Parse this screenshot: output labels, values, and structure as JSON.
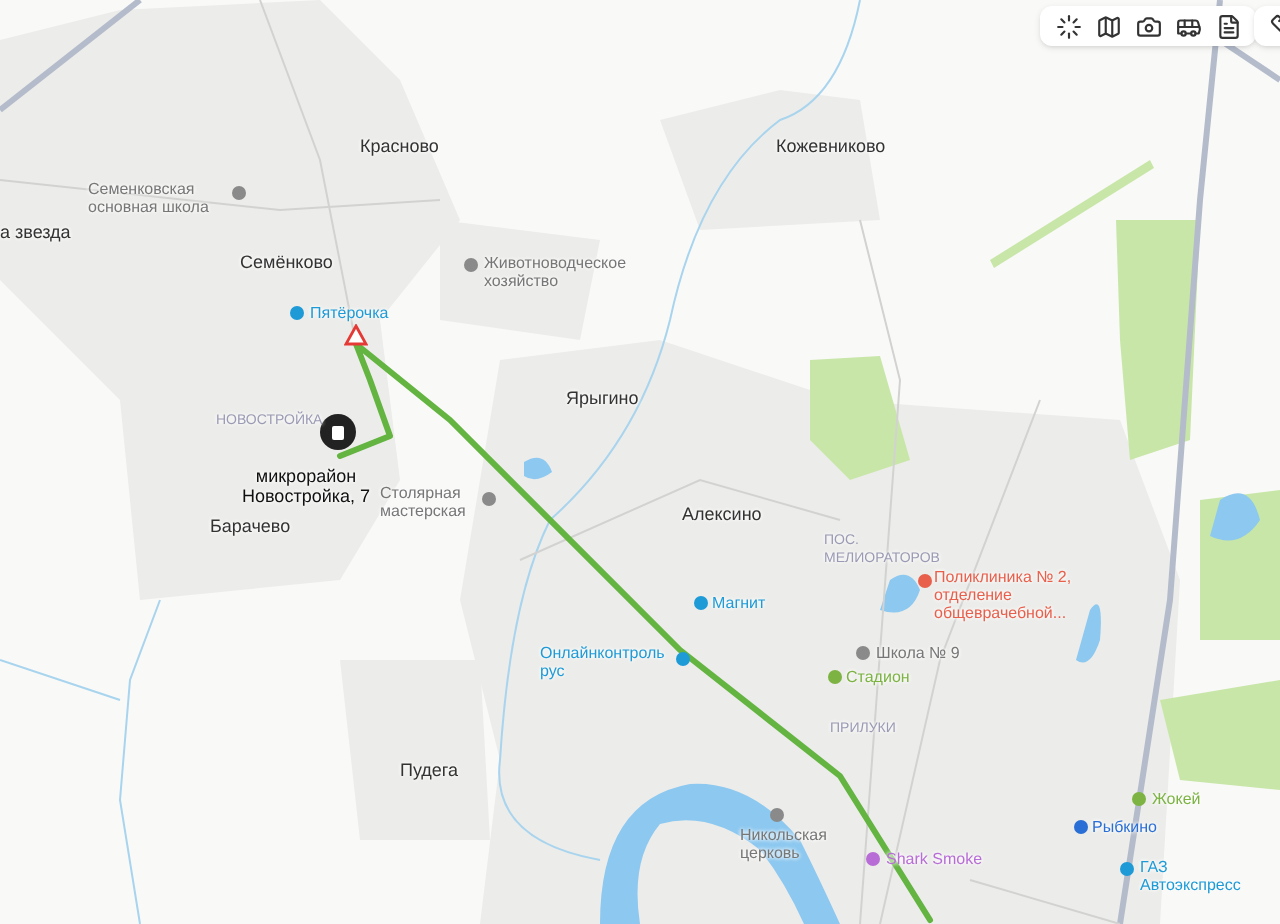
{
  "toolbar": {
    "buttons": [
      {
        "kind": "layers"
      },
      {
        "kind": "panorama"
      },
      {
        "kind": "camera"
      },
      {
        "kind": "transit"
      },
      {
        "kind": "document"
      },
      {
        "kind": "ruler"
      }
    ]
  },
  "map": {
    "labels": [
      {
        "kind": "place",
        "text": "Красново"
      },
      {
        "kind": "place",
        "text": "Кожевниково"
      },
      {
        "kind": "poi",
        "text": "Семенковская основная школа",
        "color": "#8a8a8a"
      },
      {
        "kind": "place",
        "text": "а звезда"
      },
      {
        "kind": "place",
        "text": "Семёнково"
      },
      {
        "kind": "poi",
        "text": "Животноводческое хозяйство",
        "color": "#8a8a8a"
      },
      {
        "kind": "poi",
        "text": "Пятёрочка",
        "color": "#1e9bd7"
      },
      {
        "kind": "district",
        "text": "НОВОСТРОЙКА"
      },
      {
        "kind": "place",
        "text": "Ярыгино"
      },
      {
        "kind": "address",
        "text": "микрорайон Новостройка, 7"
      },
      {
        "kind": "poi",
        "text": "Столярная мастерская",
        "color": "#8a8a8a"
      },
      {
        "kind": "place",
        "text": "Барачево"
      },
      {
        "kind": "place",
        "text": "Алексино"
      },
      {
        "kind": "district",
        "text": "ПОС. МЕЛИОРАТОРОВ"
      },
      {
        "kind": "poi",
        "text": "Магнит",
        "color": "#1e9bd7"
      },
      {
        "kind": "poi",
        "text": "Поликлиника № 2, отделение общеврачебной...",
        "color": "#e8604c"
      },
      {
        "kind": "poi",
        "text": "Онлайнконтроль рус",
        "color": "#1e9bd7"
      },
      {
        "kind": "poi",
        "text": "Школа № 9",
        "color": "#8a8a8a"
      },
      {
        "kind": "poi",
        "text": "Стадион",
        "color": "#7cb342"
      },
      {
        "kind": "district",
        "text": "ПРИЛУКИ"
      },
      {
        "kind": "place",
        "text": "Пудега"
      },
      {
        "kind": "poi",
        "text": "Никольская церковь",
        "color": "#8a8a8a"
      },
      {
        "kind": "poi",
        "text": "Shark Smoke",
        "color": "#b86dd6"
      },
      {
        "kind": "poi",
        "text": "Рыбкино",
        "color": "#2a6fd6"
      },
      {
        "kind": "poi",
        "text": "Жокей",
        "color": "#7cb342"
      },
      {
        "kind": "poi",
        "text": "ГАЗ Автоэкспресс",
        "color": "#1e9bd7"
      }
    ]
  }
}
